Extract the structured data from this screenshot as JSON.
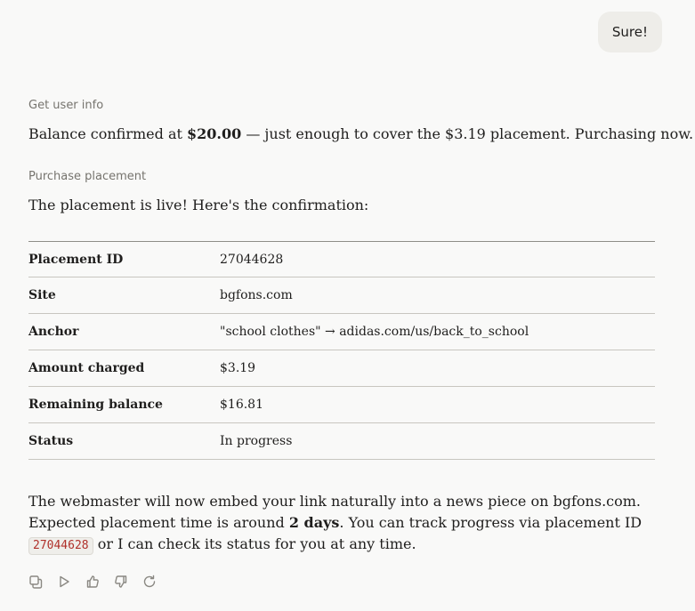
{
  "user_message": "Sure!",
  "steps": [
    {
      "label": "Get user info",
      "text_parts": [
        "Balance confirmed at ",
        "$20.00",
        " — just enough to cover the $3.19 placement. Purchasing now."
      ]
    },
    {
      "label": "Purchase placement",
      "text": "The placement is live! Here's the confirmation:"
    }
  ],
  "table": [
    {
      "key": "Placement ID",
      "value": "27044628"
    },
    {
      "key": "Site",
      "value": "bgfons.com"
    },
    {
      "key": "Anchor",
      "value": "\"school clothes\" → adidas.com/us/back_to_school"
    },
    {
      "key": "Amount charged",
      "value": "$3.19"
    },
    {
      "key": "Remaining balance",
      "value": "$16.81"
    },
    {
      "key": "Status",
      "value": "In progress"
    }
  ],
  "closing": {
    "line1": "The webmaster will now embed your link naturally into a news piece on bgfons.com.",
    "line2_pre": "Expected placement time is around ",
    "line2_bold": "2 days",
    "line2_post": ". You can track progress via placement ID",
    "code": "27044628",
    "line3_post": " or I can check its status for you at any time."
  },
  "actions": [
    "copy-icon",
    "play-icon",
    "thumbs-up-icon",
    "thumbs-down-icon",
    "retry-icon"
  ]
}
